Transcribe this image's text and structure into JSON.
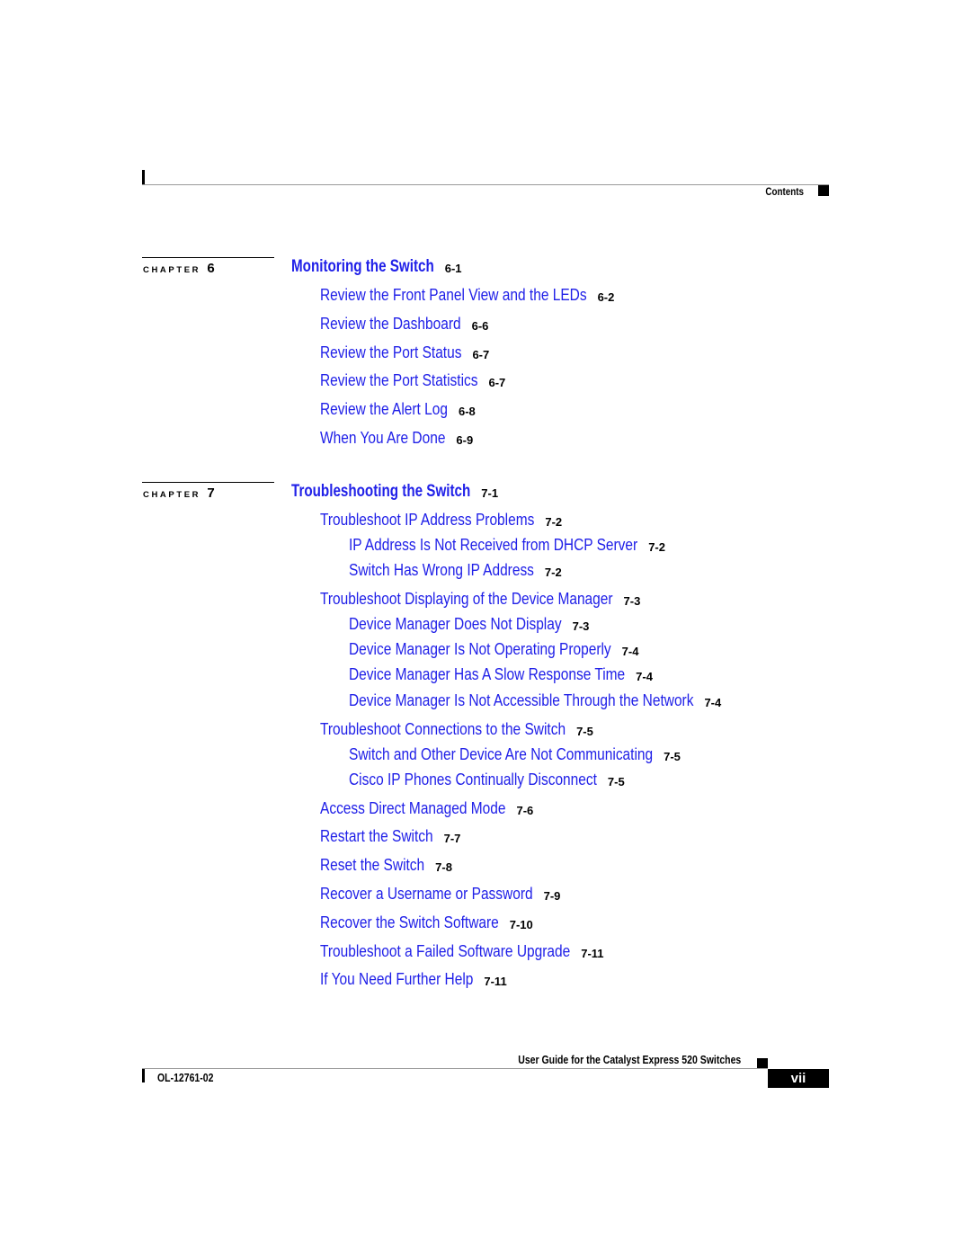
{
  "header": {
    "section_label": "Contents"
  },
  "chapters": [
    {
      "label": "CHAPTER",
      "number": "6",
      "title": "Monitoring the Switch",
      "page": "6-1",
      "entries": [
        {
          "level": 1,
          "title": "Review the Front Panel View and the LEDs",
          "page": "6-2"
        },
        {
          "level": 1,
          "title": "Review the Dashboard",
          "page": "6-6"
        },
        {
          "level": 1,
          "title": "Review the Port Status",
          "page": "6-7"
        },
        {
          "level": 1,
          "title": "Review the Port Statistics",
          "page": "6-7"
        },
        {
          "level": 1,
          "title": "Review the Alert Log",
          "page": "6-8"
        },
        {
          "level": 1,
          "title": "When You Are Done",
          "page": "6-9"
        }
      ]
    },
    {
      "label": "CHAPTER",
      "number": "7",
      "title": "Troubleshooting the Switch",
      "page": "7-1",
      "entries": [
        {
          "level": 1,
          "title": "Troubleshoot IP Address Problems",
          "page": "7-2"
        },
        {
          "level": 2,
          "title": "IP Address Is Not Received from DHCP Server",
          "page": "7-2"
        },
        {
          "level": 2,
          "title": "Switch Has Wrong IP Address",
          "page": "7-2"
        },
        {
          "level": 1,
          "title": "Troubleshoot Displaying of the Device Manager",
          "page": "7-3"
        },
        {
          "level": 2,
          "title": "Device Manager Does Not Display",
          "page": "7-3"
        },
        {
          "level": 2,
          "title": "Device Manager Is Not Operating Properly",
          "page": "7-4"
        },
        {
          "level": 2,
          "title": "Device Manager Has A Slow Response Time",
          "page": "7-4"
        },
        {
          "level": 2,
          "title": "Device Manager Is Not Accessible Through the Network",
          "page": "7-4"
        },
        {
          "level": 1,
          "title": "Troubleshoot Connections to the Switch",
          "page": "7-5"
        },
        {
          "level": 2,
          "title": "Switch and Other Device Are Not Communicating",
          "page": "7-5"
        },
        {
          "level": 2,
          "title": "Cisco IP Phones Continually Disconnect",
          "page": "7-5"
        },
        {
          "level": 1,
          "title": "Access Direct Managed Mode",
          "page": "7-6"
        },
        {
          "level": 1,
          "title": "Restart the Switch",
          "page": "7-7"
        },
        {
          "level": 1,
          "title": "Reset the Switch",
          "page": "7-8"
        },
        {
          "level": 1,
          "title": "Recover a Username or Password",
          "page": "7-9"
        },
        {
          "level": 1,
          "title": "Recover the Switch Software",
          "page": "7-10"
        },
        {
          "level": 1,
          "title": "Troubleshoot a Failed Software Upgrade",
          "page": "7-11"
        },
        {
          "level": 1,
          "title": "If You Need Further Help",
          "page": "7-11"
        }
      ]
    }
  ],
  "footer": {
    "guide_title": "User Guide for the Catalyst Express 520 Switches",
    "doc_number": "OL-12761-02",
    "page_number": "vii"
  },
  "colors": {
    "link": "#2020e8",
    "text": "#000000",
    "rule": "#9a9a9a"
  }
}
